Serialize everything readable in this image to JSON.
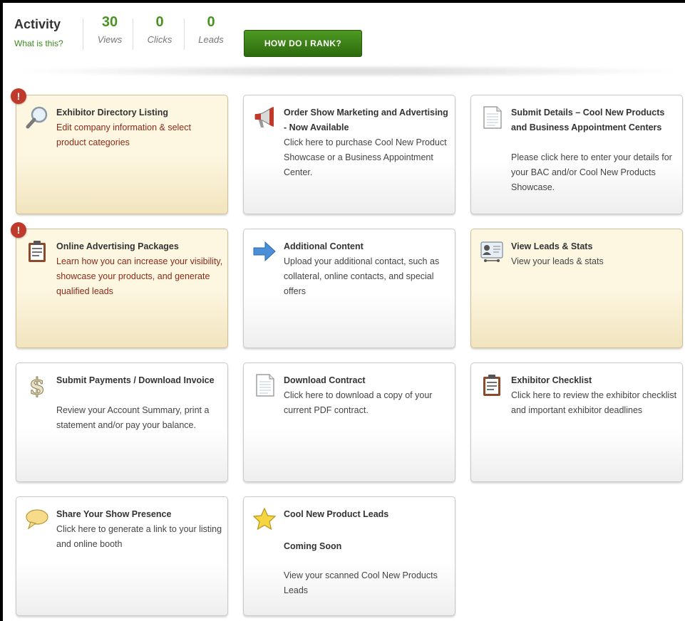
{
  "activity": {
    "title": "Activity",
    "help_link": "What is this?",
    "views": {
      "value": "30",
      "label": "Views"
    },
    "clicks": {
      "value": "0",
      "label": "Clicks"
    },
    "leads": {
      "value": "0",
      "label": "Leads"
    },
    "rank_button": "HOW DO I RANK?"
  },
  "colors": {
    "accent_green": "#4a9321",
    "alert_red": "#c0392b",
    "alert_card_bg": "#fdf6e1"
  },
  "cards": [
    {
      "title": "Exhibitor Directory Listing",
      "description": "Edit company information & select product categories",
      "icon": "magnifier-icon",
      "alert": true,
      "alert_mark": "!"
    },
    {
      "title": "Order Show Marketing and Advertising - Now Available",
      "description": "Click here to purchase Cool New Product Showcase or a Business Appointment Center.",
      "icon": "megaphone-icon",
      "alert": false
    },
    {
      "title": "Submit Details – Cool New Products and Business Appointment Centers",
      "description": "Please click here to enter your details for your BAC and/or Cool New Products Showcase.",
      "icon": "document-icon",
      "alert": false
    },
    {
      "title": "Online Advertising Packages",
      "description": "Learn how you can increase your visibility, showcase your products, and generate qualified leads",
      "icon": "clipboard-icon",
      "alert": true,
      "alert_mark": "!"
    },
    {
      "title": "Additional Content",
      "description": "Upload your additional contact, such as collateral, online contacts, and special offers",
      "icon": "arrow-right-icon",
      "alert": false
    },
    {
      "title": "View Leads & Stats",
      "description": "View your leads & stats",
      "icon": "id-card-icon",
      "alert": false
    },
    {
      "title": "Submit Payments / Download Invoice",
      "description": "Review your Account Summary, print a statement and/or pay your balance.",
      "icon": "dollar-icon",
      "alert": false
    },
    {
      "title": "Download Contract",
      "description": "Click here to download a copy of your current PDF contract.",
      "icon": "document-icon",
      "alert": false
    },
    {
      "title": "Exhibitor Checklist",
      "description": "Click here to review the exhibitor checklist and important exhibitor deadlines",
      "icon": "clipboard-icon",
      "alert": false
    },
    {
      "title": "Share Your Show Presence",
      "description": "Click here to generate a link to your listing and online booth",
      "icon": "speech-bubble-icon",
      "alert": false
    },
    {
      "title": "Cool New Product Leads",
      "subtitle": "Coming Soon",
      "description": "View your scanned Cool New Products Leads",
      "icon": "star-icon",
      "alert": false
    }
  ]
}
